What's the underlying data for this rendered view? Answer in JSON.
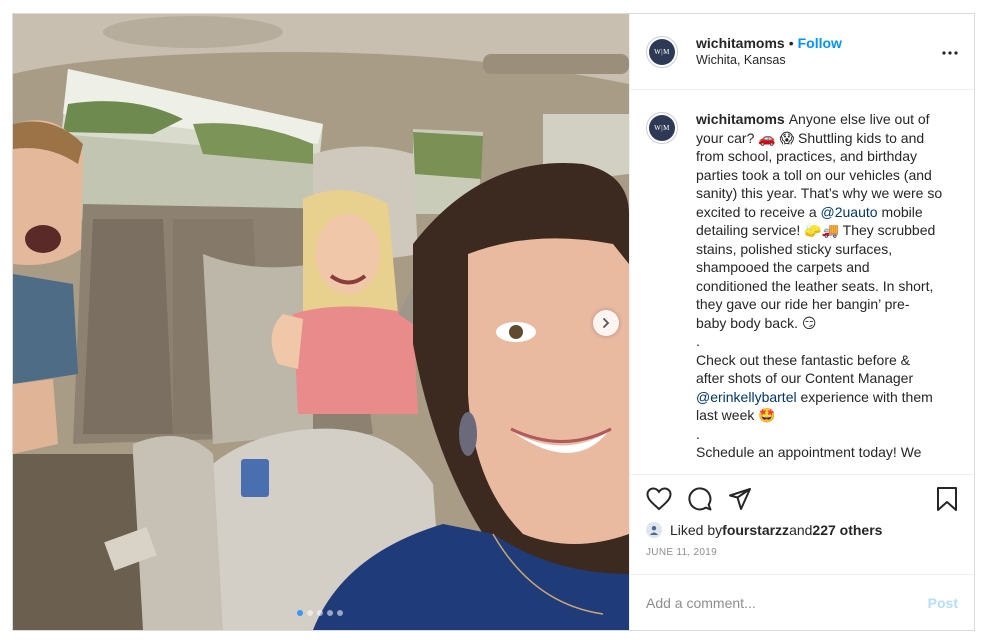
{
  "account": {
    "username": "wichitamoms",
    "separator": "•",
    "follow_label": "Follow",
    "location": "Wichita, Kansas",
    "avatar_text": "W|M"
  },
  "caption": {
    "username": "wichitamoms",
    "lines": [
      "Anyone else live out of",
      "your car? 🚗 😱 Shuttling kids to and",
      "from school, practices, and birthday",
      "parties took a toll on our vehicles (and",
      "sanity) this year. That’s why we were so",
      "excited to receive a ",
      "detailing service! 🧽🚚 They scrubbed",
      "stains, polished sticky surfaces,",
      "shampooed the carpets and",
      "conditioned the leather seats. In short,",
      "they gave our ride her bangin’ pre-",
      "baby body back. 😏",
      ".",
      "Check out these fantastic before &",
      "after shots of our Content Manager",
      " experience with them",
      "last week 🤩",
      ".",
      "Schedule an appointment today! We"
    ],
    "mention_1": "@2uauto",
    "after_mention_1": " mobile",
    "mention_2": "@erinkellybartel"
  },
  "actions": {
    "like_icon": "heart-icon",
    "comment_icon": "comment-icon",
    "share_icon": "paper-plane-icon",
    "save_icon": "bookmark-icon"
  },
  "likes": {
    "prefix": "Liked by ",
    "user": "fourstarzz",
    "middle": " and ",
    "others": "227 others"
  },
  "date": "JUNE 11, 2019",
  "comment_box": {
    "placeholder": "Add a comment...",
    "post_label": "Post"
  },
  "carousel": {
    "total": 5,
    "active_index": 0
  },
  "colors": {
    "follow_blue": "#0095f6",
    "mention_blue": "#00376b",
    "post_disabled": "#b2dffc",
    "meta_gray": "#8e8e8e"
  }
}
